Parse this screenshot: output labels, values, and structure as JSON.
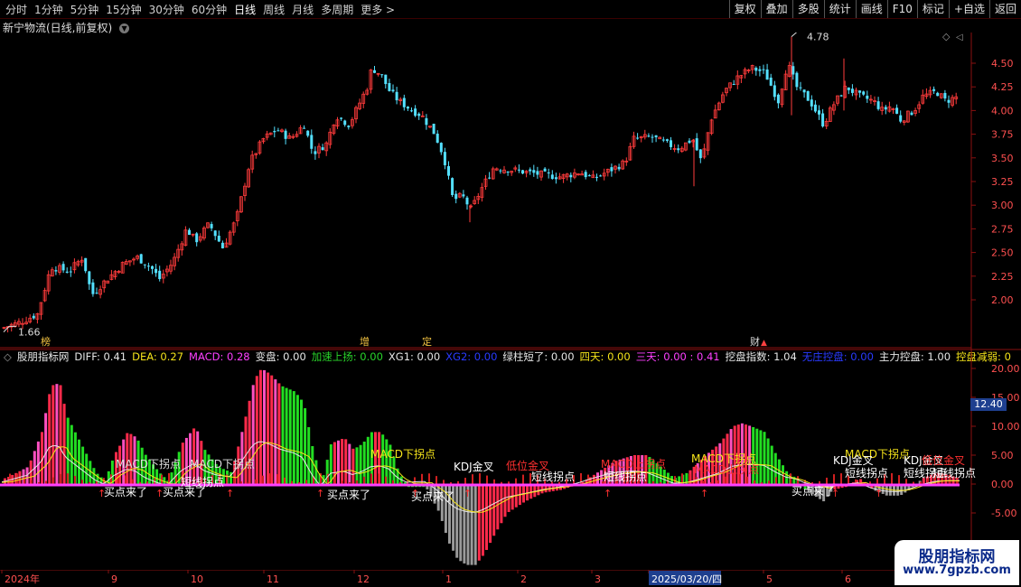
{
  "toolbar": {
    "periods": [
      "分时",
      "1分钟",
      "5分钟",
      "15分钟",
      "30分钟",
      "60分钟",
      "日线",
      "周线",
      "月线",
      "多周期",
      "更多 >"
    ],
    "active_period": "日线",
    "right_buttons": [
      "复权",
      "叠加",
      "多股",
      "统计",
      "画线",
      "F10",
      "标记",
      "+自选",
      "返回"
    ]
  },
  "stock_title": "新宁物流(日线,前复权)",
  "price_axis": [
    "4.50",
    "4.25",
    "4.00",
    "3.75",
    "3.50",
    "3.25",
    "3.00",
    "2.75",
    "2.50",
    "2.25",
    "2.00"
  ],
  "price_high_label": "4.78",
  "price_low_label": "1.66",
  "event_tags": [
    "榜",
    "增",
    "定",
    "财"
  ],
  "indicator": {
    "name": "股朋指标网",
    "values": [
      {
        "label": "DIFF: 0.41",
        "color": "#e6e6e6"
      },
      {
        "label": "DEA: 0.27",
        "color": "#f5e31a"
      },
      {
        "label": "MACD: 0.28",
        "color": "#ff40ff"
      },
      {
        "label": "变盘: 0.00",
        "color": "#e6e6e6"
      },
      {
        "label": "加速上扬: 0.00",
        "color": "#2ad42a"
      },
      {
        "label": "XG1: 0.00",
        "color": "#e6e6e6"
      },
      {
        "label": "XG2: 0.00",
        "color": "#2a3aff"
      },
      {
        "label": "绿柱短了: 0.00",
        "color": "#e6e6e6"
      },
      {
        "label": "四天: 0.00",
        "color": "#f5e31a"
      },
      {
        "label": "三天: 0.00 : 0.41",
        "color": "#ff40ff"
      },
      {
        "label": "挖盘指数: 1.04",
        "color": "#e6e6e6"
      },
      {
        "label": "无庄控盘: 0.00",
        "color": "#2a3aff"
      },
      {
        "label": "主力控盘: 1.00",
        "color": "#e6e6e6"
      },
      {
        "label": "控盘减弱: 0",
        "color": "#f5e31a"
      }
    ],
    "axis": [
      "20.00",
      "15.00",
      "10.00",
      "5.00",
      "0.00",
      "-5.00"
    ],
    "current_value": "12.40"
  },
  "signals": {
    "macd": "MACD下拐点",
    "buy": "买点来了",
    "short": "短线拐点",
    "kdj": "KDJ金叉",
    "low_gold": "低位金叉",
    "macd_up": "MACD上拐点"
  },
  "date_axis": [
    "2024年",
    "9",
    "10",
    "11",
    "12",
    "1",
    "2",
    "3",
    "2025/03/20/四",
    "5",
    "6"
  ],
  "watermark": {
    "title": "股朋指标网",
    "url": "www.7gpzb.com"
  },
  "colors": {
    "up": "#ff3b3b",
    "down": "#54e0ff",
    "green_bar": "#22dd22",
    "grey_bar": "#9a9a9a",
    "magenta": "#ff40ff",
    "yellow": "#f5e31a"
  }
}
